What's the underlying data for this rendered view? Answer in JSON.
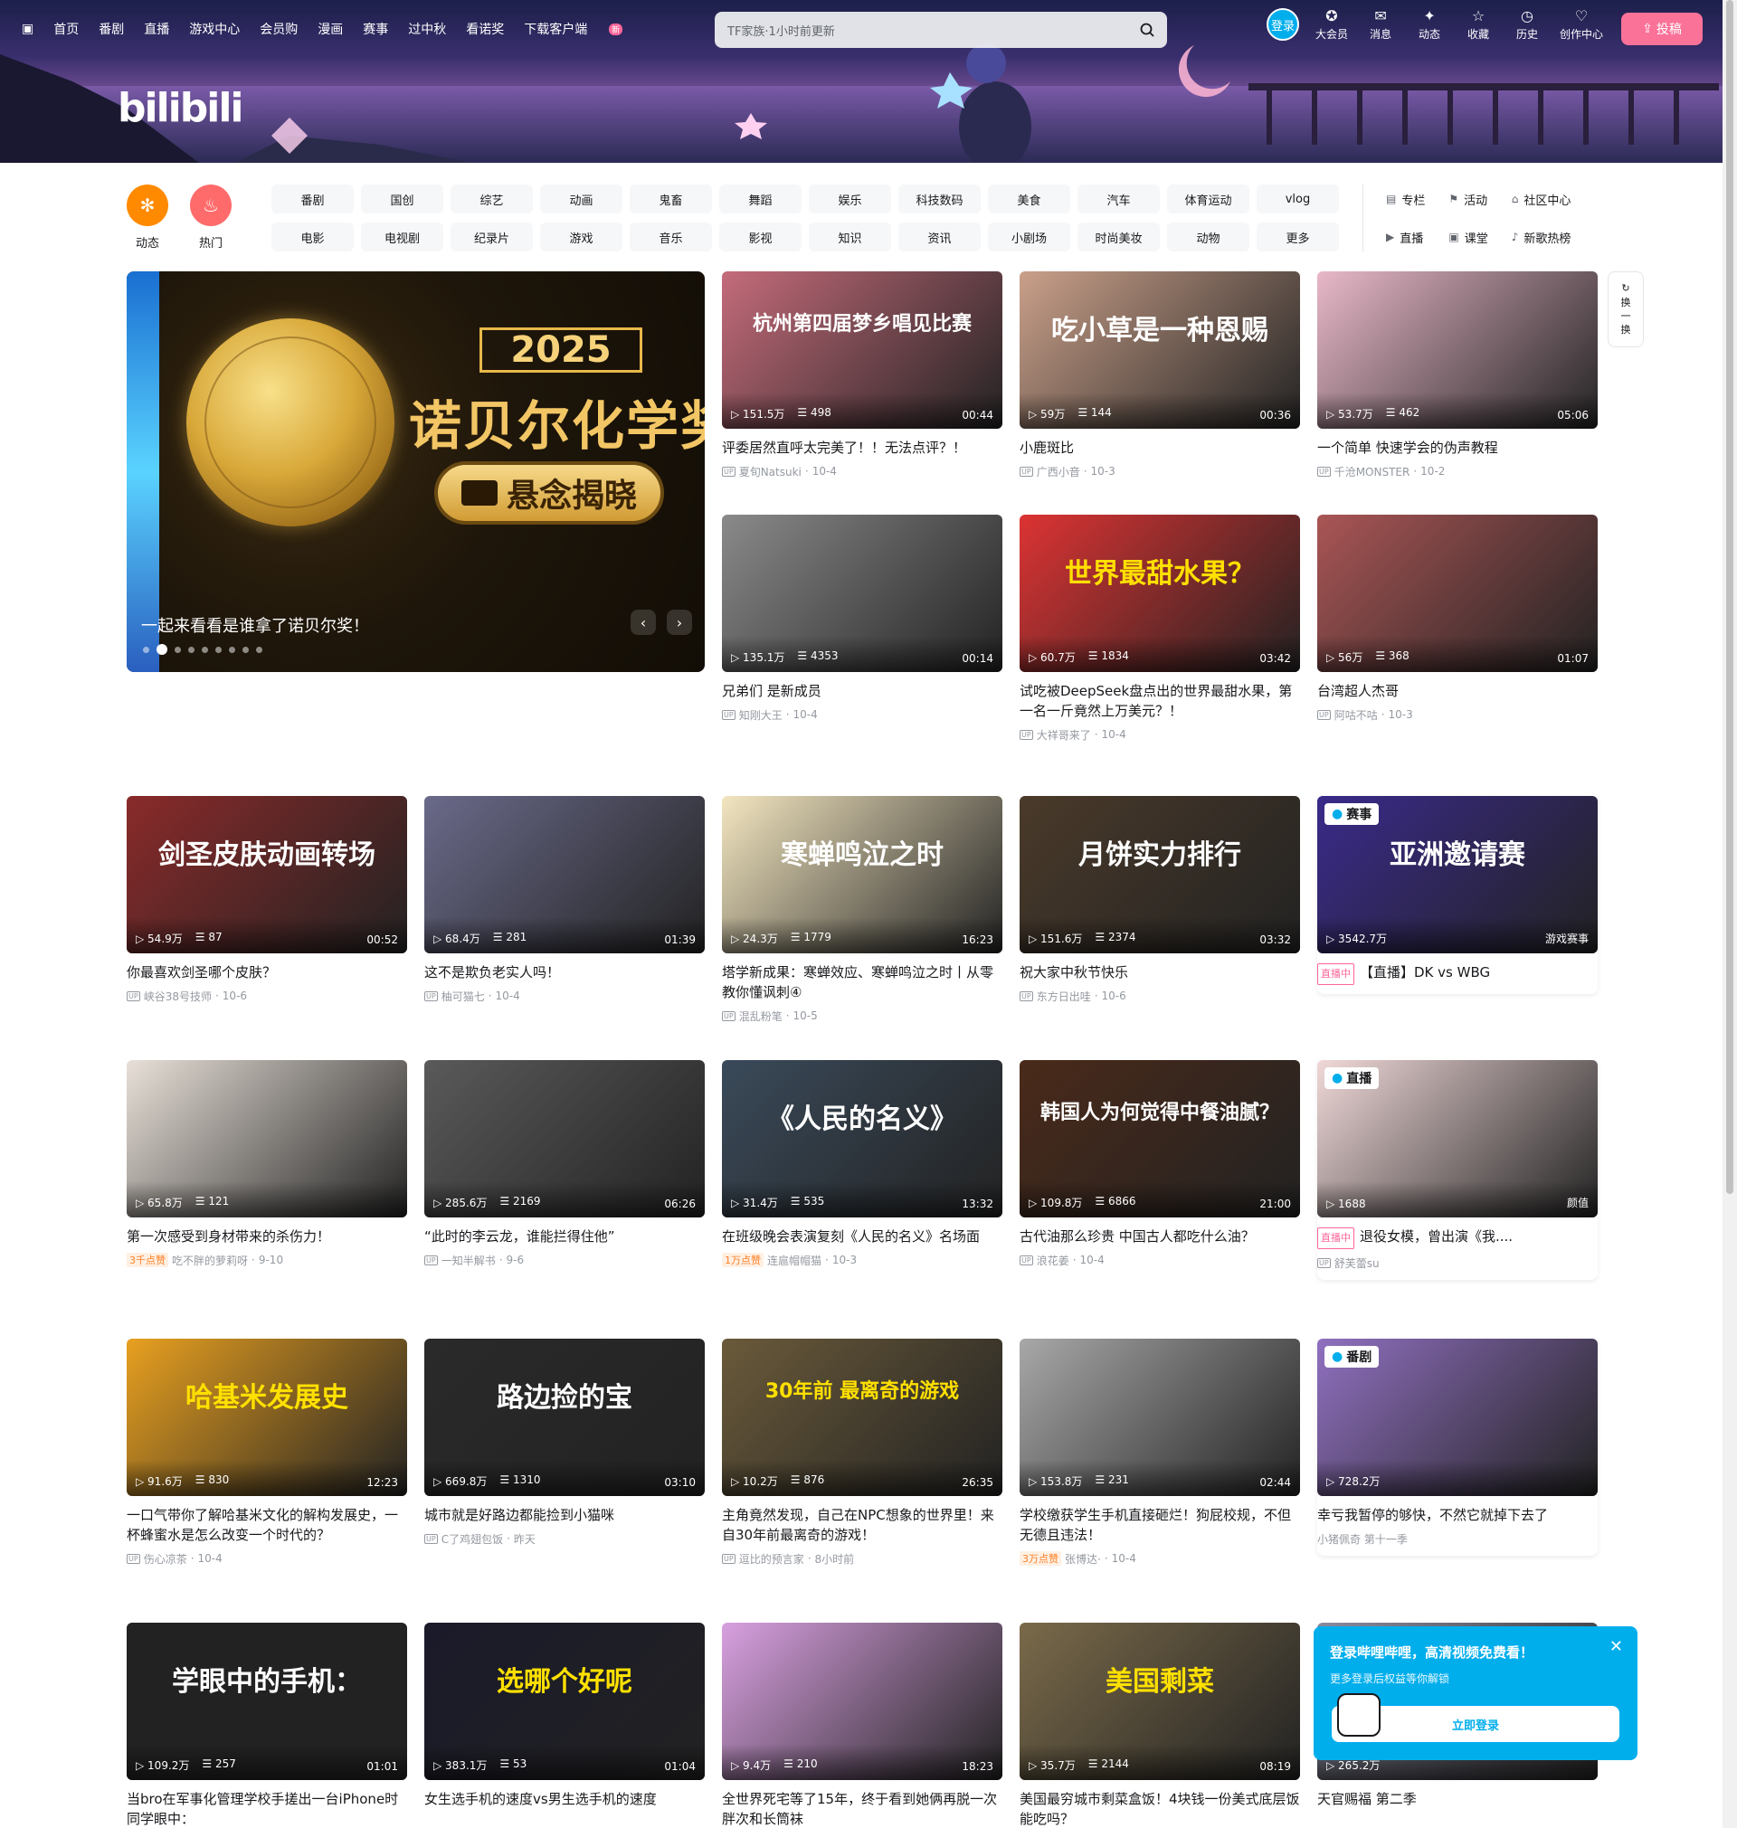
{
  "header": {
    "nav_left": [
      "首页",
      "番剧",
      "直播",
      "游戏中心",
      "会员购",
      "漫画",
      "赛事",
      "过中秋",
      "看诺奖",
      "下载客户端"
    ],
    "new_badge": "新",
    "search_placeholder": "TF家族·1小时前更新",
    "login": "登录",
    "nav_right": [
      "大会员",
      "消息",
      "动态",
      "收藏",
      "历史",
      "创作中心"
    ],
    "upload": "投稿",
    "logo": "bilibili"
  },
  "channels": {
    "big": [
      "动态",
      "热门"
    ],
    "chips": [
      "番剧",
      "国创",
      "综艺",
      "动画",
      "鬼畜",
      "舞蹈",
      "娱乐",
      "科技数码",
      "美食",
      "汽车",
      "体育运动",
      "vlog",
      "电影",
      "电视剧",
      "纪录片",
      "游戏",
      "音乐",
      "影视",
      "知识",
      "资讯",
      "小剧场",
      "时尚美妆",
      "动物",
      "更多"
    ],
    "tools": [
      "专栏",
      "活动",
      "社区中心",
      "直播",
      "课堂",
      "新歌热榜"
    ]
  },
  "carousel": {
    "year": "2025",
    "title": "诺贝尔化学奖",
    "pill": "悬念揭晓",
    "caption": "一起来看看是谁拿了诺贝尔奖！",
    "dots": 9,
    "active_dot": 1
  },
  "refresh_label": [
    "换",
    "一",
    "换"
  ],
  "cards": [
    {
      "views": "151.5万",
      "danmaku": "498",
      "dur": "00:44",
      "title": "评委居然直呼太完美了！！无法点评？！",
      "author": "夏旬Natsuki",
      "date": "10-4",
      "ov": "杭州第四届梦乡唱见比赛"
    },
    {
      "views": "59万",
      "danmaku": "144",
      "dur": "00:36",
      "title": "小鹿斑比",
      "author": "广西小音",
      "date": "10-3",
      "ov": "吃小草是一种恩赐"
    },
    {
      "views": "53.7万",
      "danmaku": "462",
      "dur": "05:06",
      "title": "一个简单 快速学会的伪声教程",
      "author": "千沧MONSTER",
      "date": "10-2",
      "ov": ""
    },
    {
      "views": "135.1万",
      "danmaku": "4353",
      "dur": "00:14",
      "title": "兄弟们 是新成员",
      "author": "知刚大王",
      "date": "10-4",
      "ov": ""
    },
    {
      "views": "60.7万",
      "danmaku": "1834",
      "dur": "03:42",
      "title": "试吃被DeepSeek盘点出的世界最甜水果，第一名一斤竟然上万美元？！",
      "author": "大祥哥来了",
      "date": "10-4",
      "ov": "世界最甜水果？"
    },
    {
      "views": "56万",
      "danmaku": "368",
      "dur": "01:07",
      "title": "台湾超人杰哥",
      "author": "阿咕不咕",
      "date": "10-3",
      "ov": ""
    },
    {
      "views": "54.9万",
      "danmaku": "87",
      "dur": "00:52",
      "title": "你最喜欢剑圣哪个皮肤？",
      "author": "峡谷38号技师",
      "date": "10-6",
      "ov": "剑圣皮肤动画转场"
    },
    {
      "views": "68.4万",
      "danmaku": "281",
      "dur": "01:39",
      "title": "这不是欺负老实人吗！",
      "author": "柚可猫七",
      "date": "10-4",
      "ov": ""
    },
    {
      "views": "24.3万",
      "danmaku": "1779",
      "dur": "16:23",
      "title": "塔学新成果：寒蝉效应、寒蝉鸣泣之时丨从零教你懂讽刺④",
      "author": "混乱粉笔",
      "date": "10-5",
      "ov": "寒蝉鸣泣之时"
    },
    {
      "views": "151.6万",
      "danmaku": "2374",
      "dur": "03:32",
      "title": "祝大家中秋节快乐",
      "author": "东方日出哇",
      "date": "10-6",
      "ov": "月饼实力排行"
    },
    {
      "views": "3542.7万",
      "danmaku": "",
      "dur": "游戏赛事",
      "title": "【直播】DK vs WBG",
      "author": "",
      "date": "",
      "ov": "亚洲邀请赛",
      "tag": "赛事",
      "live": "直播中"
    },
    {
      "views": "65.8万",
      "danmaku": "121",
      "dur": "",
      "title": "第一次感受到身材带来的杀伤力！",
      "author": "吃不胖的萝莉呀",
      "date": "9-10",
      "ov": "",
      "likes": "3千点赞"
    },
    {
      "views": "285.6万",
      "danmaku": "2169",
      "dur": "06:26",
      "title": "“此时的李云龙，谁能拦得住他”",
      "author": "一知半解书",
      "date": "9-6",
      "ov": ""
    },
    {
      "views": "31.4万",
      "danmaku": "535",
      "dur": "13:32",
      "title": "在班级晚会表演复刻《人民的名义》名场面",
      "author": "连扈帽帽猫",
      "date": "10-3",
      "ov": "《人民的名义》",
      "likes": "1万点赞"
    },
    {
      "views": "109.8万",
      "danmaku": "6866",
      "dur": "21:00",
      "title": "古代油那么珍贵 中国古人都吃什么油？",
      "author": "浪花姜",
      "date": "10-4",
      "ov": "韩国人为何觉得中餐油腻？"
    },
    {
      "views": "1688",
      "danmaku": "",
      "dur": "颜值",
      "title": "退役女模，曾出演《我....",
      "author": "舒芙蕾su",
      "date": "",
      "ov": "",
      "tag": "直播",
      "live": "直播中"
    },
    {
      "views": "91.6万",
      "danmaku": "830",
      "dur": "12:23",
      "title": "一口气带你了解哈基米文化的解构发展史，一杯蜂蜜水是怎么改变一个时代的？",
      "author": "伤心凉茶",
      "date": "10-4",
      "ov": "哈基米发展史"
    },
    {
      "views": "669.8万",
      "danmaku": "1310",
      "dur": "03:10",
      "title": "城市就是好路边都能捡到小猫咪",
      "author": "C了鸡翅包饭",
      "date": "昨天",
      "ov": "路边捡的宝"
    },
    {
      "views": "10.2万",
      "danmaku": "876",
      "dur": "26:35",
      "title": "主角竟然发现，自己在NPC想象的世界里！来自30年前最离奇的游戏！",
      "author": "逗比的预言家",
      "date": "8小时前",
      "ov": "30年前 最离奇的游戏"
    },
    {
      "views": "153.8万",
      "danmaku": "231",
      "dur": "02:44",
      "title": "学校缴获学生手机直接砸烂！狗屁校规，不但无德且违法！",
      "author": "张博达·",
      "date": "10-4",
      "ov": "",
      "likes": "3万点赞"
    },
    {
      "views": "728.2万",
      "danmaku": "",
      "dur": "",
      "title": "幸亏我暂停的够快，不然它就掉下去了",
      "author": "小猪佩奇 第十一季",
      "date": "",
      "ov": "",
      "tag": "番剧"
    },
    {
      "views": "109.2万",
      "danmaku": "257",
      "dur": "01:01",
      "title": "当bro在军事化管理学校手搓出一台iPhone时 同学眼中：",
      "author": "",
      "date": "",
      "ov": "学眼中的手机："
    },
    {
      "views": "383.1万",
      "danmaku": "53",
      "dur": "01:04",
      "title": "女生选手机的速度vs男生选手机的速度",
      "author": "",
      "date": "",
      "ov": "选哪个好呢"
    },
    {
      "views": "9.4万",
      "danmaku": "210",
      "dur": "18:23",
      "title": "全世界死宅等了15年，终于看到她俩再脱一次胖次和长筒袜",
      "author": "",
      "date": "",
      "ov": ""
    },
    {
      "views": "35.7万",
      "danmaku": "2144",
      "dur": "08:19",
      "title": "美国最穷城市剩菜盒饭！4块钱一份美式底层饭能吃吗？",
      "author": "",
      "date": "",
      "ov": "美国剩菜"
    },
    {
      "views": "265.2万",
      "danmaku": "",
      "dur": "",
      "title": "天官赐福 第二季",
      "author": "",
      "date": "",
      "ov": ""
    }
  ],
  "popup": {
    "title": "登录哔哩哔哩，高清视频免费看！",
    "sub": "更多登录后权益等你解锁",
    "button": "立即登录"
  },
  "colors": {
    "accent": "#00aeec",
    "pink": "#fb7299",
    "orange": "#ff8a00",
    "hot": "#ff6b6b"
  }
}
